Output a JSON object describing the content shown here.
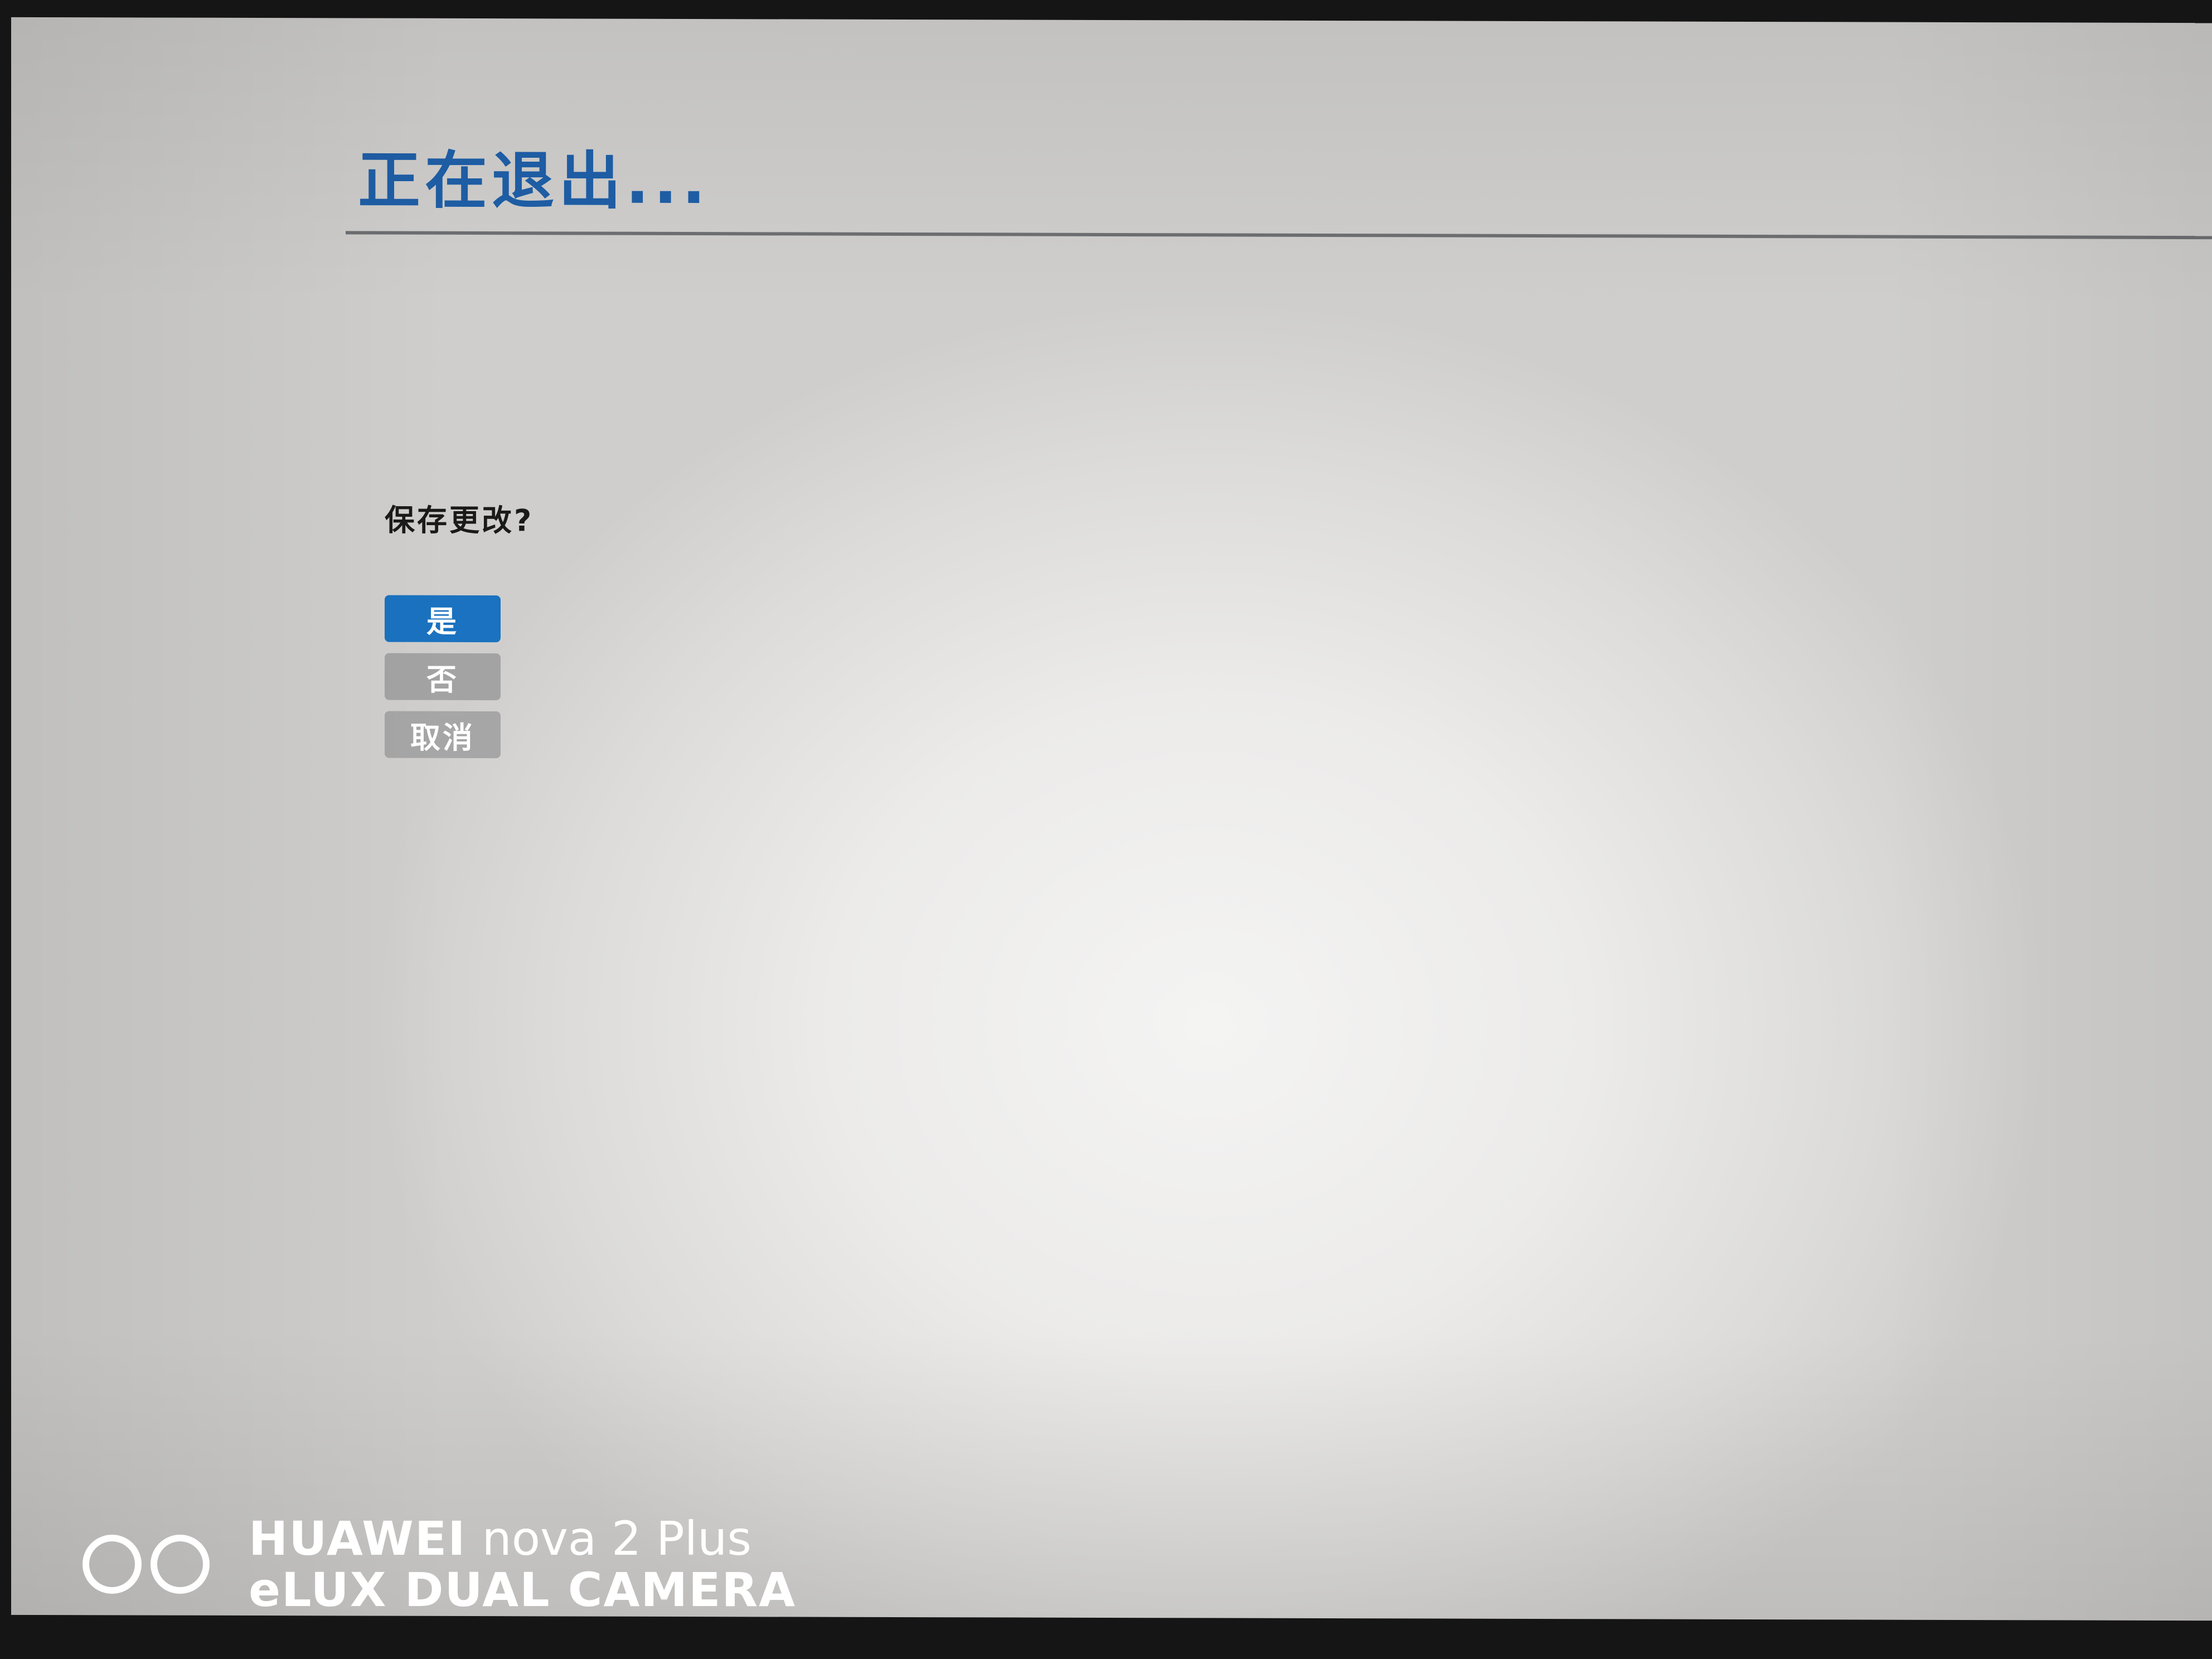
{
  "header": {
    "title": "正在退出..."
  },
  "dialog": {
    "prompt": "保存更改?",
    "options": [
      {
        "label": "是",
        "selected": true
      },
      {
        "label": "否",
        "selected": false
      },
      {
        "label": "取消",
        "selected": false
      }
    ]
  },
  "watermark": {
    "brand": "HUAWEI",
    "model": "nova 2 Plus",
    "line2": "eLUX  DUAL CAMERA"
  },
  "colors": {
    "title": "#1f5fa8",
    "selected_button": "#1a72c0",
    "unselected_button": "#a3a3a3"
  }
}
